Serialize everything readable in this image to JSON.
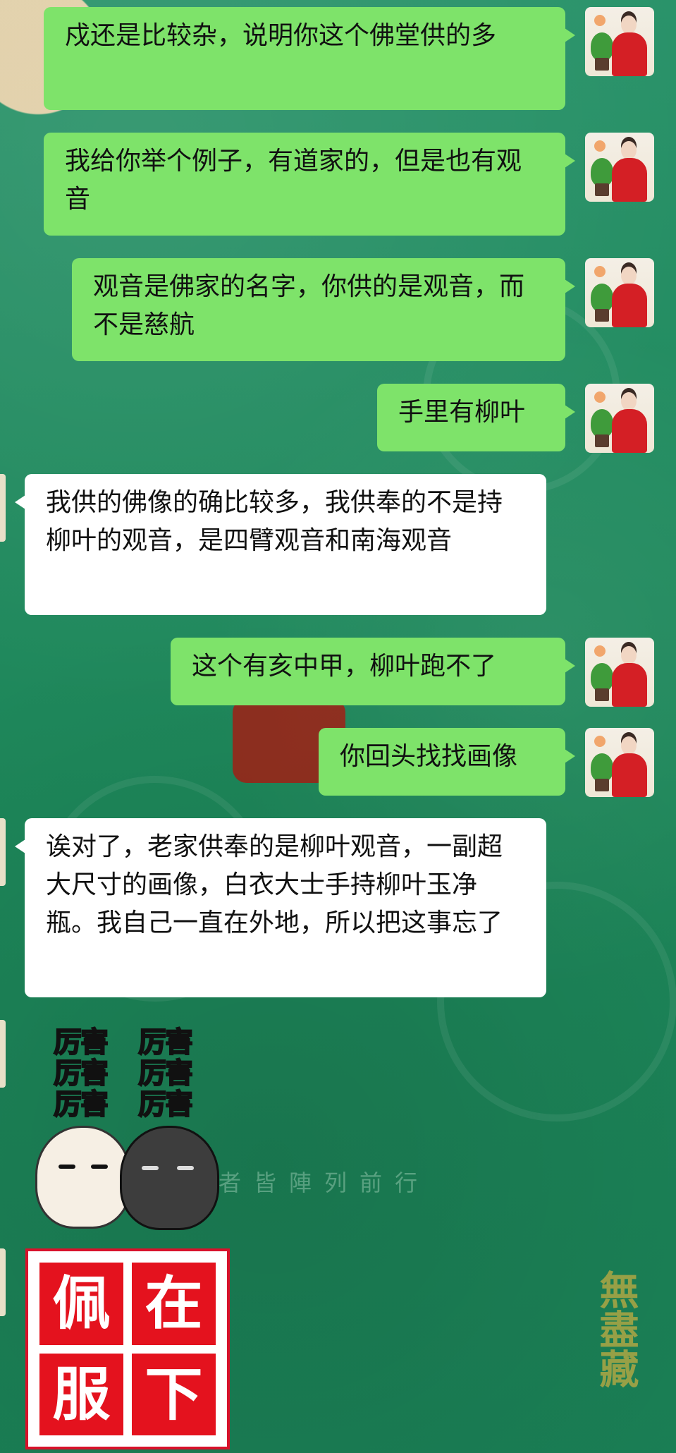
{
  "messages": [
    {
      "side": "out",
      "text": "戍还是比较杂，说明你这个佛堂供的多"
    },
    {
      "side": "out",
      "text": "我给你举个例子，有道家的，但是也有观音"
    },
    {
      "side": "out",
      "text": "观音是佛家的名字，你供的是观音，而不是慈航"
    },
    {
      "side": "out",
      "text": "手里有柳叶"
    },
    {
      "side": "in",
      "text": "我供的佛像的确比较多，我供奉的不是持柳叶的观音，是四臂观音和南海观音"
    },
    {
      "side": "out",
      "text": "这个有亥中甲，柳叶跑不了"
    },
    {
      "side": "out",
      "text": "你回头找找画像"
    },
    {
      "side": "in",
      "text": "诶对了，老家供奉的是柳叶观音，一副超大尺寸的画像，白衣大士手持柳叶玉净瓶。我自己一直在外地，所以把这事忘了"
    }
  ],
  "stickers": {
    "cats_lines": [
      "厉害",
      "厉害",
      "厉害",
      "厉害",
      "厉害",
      "厉害"
    ],
    "stamp_chars": [
      "佩",
      "在",
      "服",
      "下"
    ]
  },
  "background": {
    "verse": "者皆陣列前行",
    "watermark": "無盡藏"
  },
  "colors": {
    "outgoing_bubble": "#7ee36a",
    "incoming_bubble": "#ffffff",
    "background": "#1f8a5e",
    "stamp_red": "#e4121e"
  }
}
